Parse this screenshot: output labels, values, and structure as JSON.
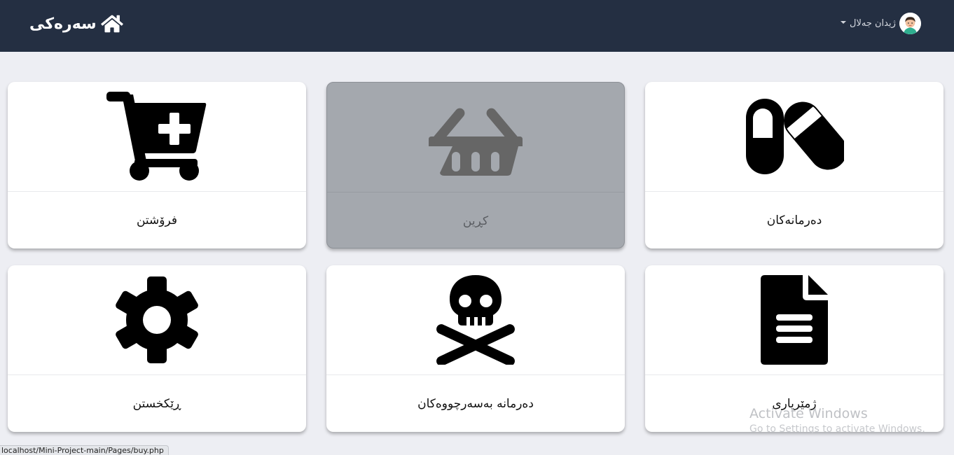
{
  "navbar": {
    "brand": "سەرەکی",
    "user_name": "ژیدان جەلال"
  },
  "cards": [
    {
      "label": "دەرمانەکان",
      "icon": "pills-icon",
      "active": false
    },
    {
      "label": "کڕین",
      "icon": "shopping-basket-icon",
      "active": true
    },
    {
      "label": "فرۆشتن",
      "icon": "cart-plus-icon",
      "active": false
    },
    {
      "label": "ژمێریاری",
      "icon": "file-document-icon",
      "active": false
    },
    {
      "label": "دەرمانە بەسەرچووەکان",
      "icon": "skull-crossbones-icon",
      "active": false
    },
    {
      "label": "ڕێکخستن",
      "icon": "gear-icon",
      "active": false
    }
  ],
  "windows_watermark": {
    "title": "Activate Windows",
    "subtitle": "Go to Settings to activate Windows."
  },
  "status_bar": {
    "url": "localhost/Mini-Project-main/Pages/buy.php"
  },
  "colors": {
    "navbar": "#242f42",
    "page_background": "#edeef3",
    "active_card": "#a4a8ae",
    "icon": "#000000",
    "active_icon": "#666666"
  }
}
